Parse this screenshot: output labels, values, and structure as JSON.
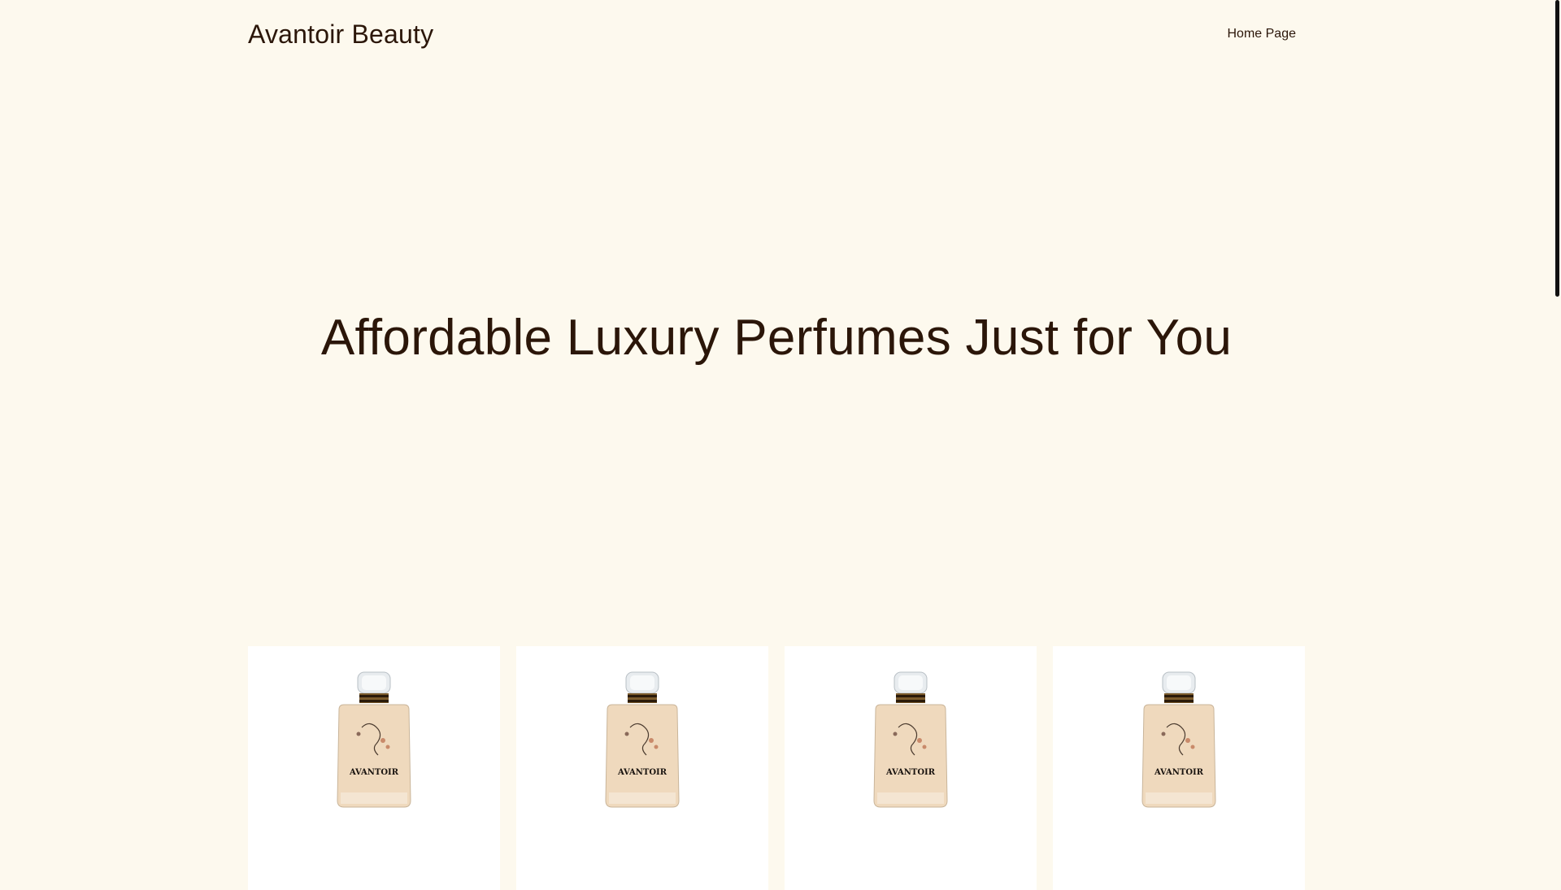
{
  "header": {
    "site_title": "Avantoir Beauty",
    "nav": {
      "home_label": "Home Page"
    }
  },
  "hero": {
    "heading": "Affordable Luxury Perfumes Just for You"
  },
  "products": {
    "items": [
      {
        "image_label": "AVANTOIR",
        "icon": "perfume-bottle"
      },
      {
        "image_label": "AVANTOIR",
        "icon": "perfume-bottle"
      },
      {
        "image_label": "AVANTOIR",
        "icon": "perfume-bottle"
      },
      {
        "image_label": "AVANTOIR",
        "icon": "perfume-bottle"
      }
    ]
  },
  "colors": {
    "background": "#fdf9ee",
    "text": "#2b1609",
    "card": "#ffffff"
  }
}
